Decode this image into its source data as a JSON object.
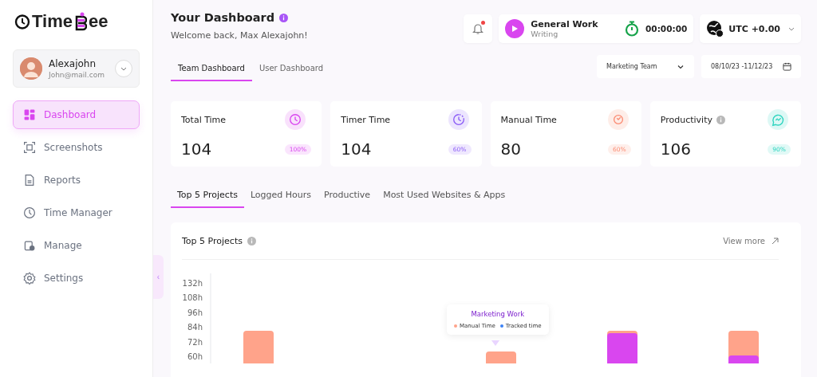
{
  "sidebar": {
    "logo": {
      "text_start": "Time",
      "text_end": "ee"
    },
    "profile": {
      "name": "Alexajohn",
      "email": "John@mail.com"
    },
    "items": [
      {
        "label": "Dashboard",
        "selected": true
      },
      {
        "label": "Screenshots",
        "selected": false
      },
      {
        "label": "Reports",
        "selected": false
      },
      {
        "label": "Time Manager",
        "selected": false
      },
      {
        "label": "Manage",
        "selected": false
      },
      {
        "label": "Settings",
        "selected": false
      }
    ],
    "collapse_toggle": "‹"
  },
  "header": {
    "title": "Your Dashboard",
    "subtitle": "Welcome back, Max Alexajohn!",
    "notifications": {
      "unread": true
    },
    "timer": {
      "project": "General Work",
      "task": "Writing",
      "elapsed": "00:00:00"
    },
    "timezone": "UTC +0.00"
  },
  "tabs": [
    {
      "label": "Team Dashboard",
      "selected": true
    },
    {
      "label": "User Dashboard",
      "selected": false
    }
  ],
  "filters": {
    "team": "Marketing Team",
    "date_range": "08/10/23 -11/12/23"
  },
  "stats": [
    {
      "title": "Total Time",
      "value": "104",
      "percent": "100%",
      "color": "#d946ef",
      "info": false
    },
    {
      "title": "Timer Time",
      "value": "104",
      "percent": "60%",
      "color": "#8b5cf6",
      "info": false
    },
    {
      "title": "Manual Time",
      "value": "80",
      "percent": "60%",
      "color": "#fb8c73",
      "info": false
    },
    {
      "title": "Productivity",
      "value": "106",
      "percent": "90%",
      "color": "#2dd4bf",
      "info": true
    }
  ],
  "section_tabs": [
    {
      "label": "Top 5 Projects",
      "selected": true
    },
    {
      "label": "Logged Hours",
      "selected": false
    },
    {
      "label": "Productive",
      "selected": false
    },
    {
      "label": "Most Used Websites & Apps",
      "selected": false
    }
  ],
  "projects_panel": {
    "title": "Top 5 Projects",
    "view_more": "View more",
    "y_axis_labels": [
      "132h",
      "108h",
      "96h",
      "84h",
      "72h",
      "60h"
    ],
    "tooltip": {
      "title": "Marketing Work",
      "legend": [
        {
          "label": "Manual Time",
          "color": "#ffa38a"
        },
        {
          "label": "Tracked time",
          "color": "#3b82f6"
        }
      ]
    }
  }
}
